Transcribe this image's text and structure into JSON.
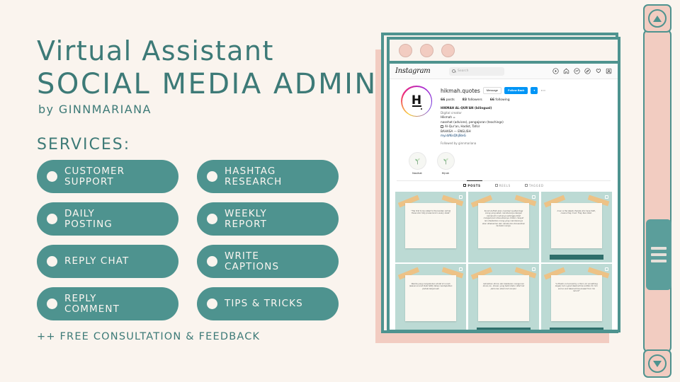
{
  "poster": {
    "title_line1": "Virtual Assistant",
    "title_line2": "SOCIAL MEDIA ADMIN",
    "byline": "by GINNMARIANA",
    "services_label": "SERVICES:",
    "footer_note": "++ FREE CONSULTATION & FEEDBACK",
    "accent_teal": "#4E938F",
    "title_teal": "#3D7A77",
    "background_cream": "#FAF4EE",
    "pink": "#F2CCC1"
  },
  "services": [
    {
      "label": "CUSTOMER\nSUPPORT"
    },
    {
      "label": "HASHTAG\nRESEARCH"
    },
    {
      "label": "DAILY\nPOSTING"
    },
    {
      "label": "WEEKLY\nREPORT"
    },
    {
      "label": "REPLY CHAT"
    },
    {
      "label": "WRITE\nCAPTIONS"
    },
    {
      "label": "REPLY\nCOMMENT"
    },
    {
      "label": "TIPS & TRICKS"
    }
  ],
  "browser": {
    "dots": [
      "window-dot-1",
      "window-dot-2",
      "window-dot-3"
    ]
  },
  "instagram": {
    "logo": "Instagram",
    "search_placeholder": "Search",
    "nav_icons": [
      "new-post-icon",
      "home-icon",
      "messenger-icon",
      "explore-icon",
      "heart-icon",
      "profile-avatar-icon"
    ],
    "profile": {
      "avatar_letter": "H",
      "username": "hikmah.quotes",
      "message_button": "Message",
      "follow_button": "Follow Back",
      "more_button": "⋯",
      "stats": [
        {
          "value": "66",
          "label": "posts"
        },
        {
          "value": "83",
          "label": "followers"
        },
        {
          "value": "66",
          "label": "following"
        }
      ],
      "bio": [
        "HIKMAH AL-QUR'AN (bilingual)",
        "Digital creator",
        "Hikmah =",
        "nasehat (advices), pengajaran (teachings)",
        "Al-Qur'an, Hadist, Tafsir",
        "BAHASA — ENGLISH",
        "my.id/KisQhjSteG"
      ],
      "followed_by": "Followed by ginnmariana"
    },
    "highlights": [
      {
        "label": "Nasihat"
      },
      {
        "label": "Hijrah"
      }
    ],
    "tabs": [
      {
        "label": "POSTS",
        "active": true
      },
      {
        "label": "REELS",
        "active": false
      },
      {
        "label": "TAGGED",
        "active": false
      }
    ],
    "posts": [
      {
        "text": "\"The first to be called to the Garden will be those who fully praise God in every state\"",
        "banner": false,
        "multi": true
      },
      {
        "text": "Surah Al-Mulk akan memberi syafaat bagi orang yang selalu membacanya dengan memenuhi maknanya sehingga Allah mengampuni dosa-dosanya. Dalam riwayat lain disebutkan orang yang membacanya akan dikeluarkan dari neraka dan dimasukkan ke dalam surga.",
        "banner": false,
        "multi": true
      },
      {
        "text": "Iman is the deeds. People who have faith, means they trust. They fear Allah.",
        "banner": true,
        "multi": true
      },
      {
        "text": "Wanita yang menjalankan sholat di rumah (sesuai sunnah Nabi SAW) tetap mendapatkan pahala berjamaah",
        "banner": false,
        "multi": true
      },
      {
        "text": "Isbirahkan dirimu dari kesibukan mengurusi dunia-mu. Urusan yang telah diatur Allah tak perlu kau sibuk ikut campur",
        "banner": true,
        "multi": true
      },
      {
        "text": "\"A Muslim is harmed by a thorn (or something larger) but a good deed will be written for him and an evil deed will be erased from his record\"",
        "banner": true,
        "multi": true
      }
    ]
  },
  "scrollbar": {
    "up_arrow": "scroll-up",
    "down_arrow": "scroll-down",
    "thumb": "scroll-thumb"
  }
}
